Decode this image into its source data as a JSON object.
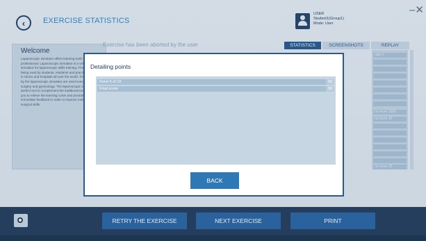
{
  "header": {
    "title": "EXERCISE STATISTICS",
    "user": {
      "name": "USER",
      "group": "Student1(Group1)",
      "mode": "Mode: User"
    }
  },
  "welcome": {
    "heading": "Welcome",
    "text": "Laparoscopic simulator offers learning tools for medical professional. Laparoscopic simulator is a virtual reality simulator for laparoscopic skills training. The device is being used by students, residents and practising surgeons in clinics and hospitals all over the world. The skills trained by the laparoscopic simulator are used everyday in general surgery and gynecology. The laparoscopic simulator is a perfect tool to complement the traditional training it helps you to relieve the learning curve and provides an immediate feedback in order to improve minimal invasive surgical skills."
  },
  "status_message": "Exercise has been aborted by the user",
  "tabs": [
    "STATISTICS",
    "SCREENSHOTS",
    "REPLAY"
  ],
  "stats_side": {
    "rows": [
      {
        "text": "ngle 2"
      },
      {
        "text": ""
      },
      {
        "text": ""
      },
      {
        "text": ""
      },
      {
        "text": ""
      },
      {
        "text": ""
      },
      {
        "text": ""
      },
      {
        "text": ""
      },
      {
        "text": "no more 1000"
      },
      {
        "text": "no more 10"
      },
      {
        "text": ""
      },
      {
        "text": ""
      },
      {
        "text": ""
      },
      {
        "text": ""
      },
      {
        "text": ""
      },
      {
        "text": ""
      },
      {
        "text": "no more 20"
      }
    ]
  },
  "modal": {
    "title": "Detailing points",
    "rows": [
      {
        "label": "Done 5 of 10",
        "value": "50"
      },
      {
        "label": "Final score",
        "value": "50"
      }
    ],
    "back_label": "BACK"
  },
  "bottom": {
    "retry_label": "RETRY THE EXERCISE",
    "next_label": "NEXT EXERCISE",
    "print_label": "PRINT"
  }
}
